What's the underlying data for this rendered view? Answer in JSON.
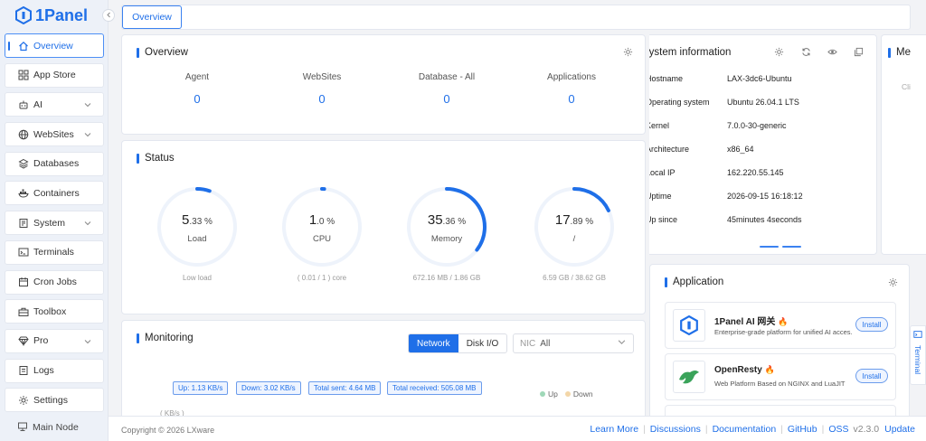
{
  "app": {
    "name": "1Panel"
  },
  "nav": [
    {
      "label": "Overview",
      "icon": "home-icon",
      "active": true
    },
    {
      "label": "App Store",
      "icon": "grid-icon"
    },
    {
      "label": "AI",
      "icon": "robot-icon",
      "expand": true
    },
    {
      "label": "WebSites",
      "icon": "globe-icon",
      "expand": true
    },
    {
      "label": "Databases",
      "icon": "database-icon"
    },
    {
      "label": "Containers",
      "icon": "docker-icon"
    },
    {
      "label": "System",
      "icon": "system-icon",
      "expand": true
    },
    {
      "label": "Terminals",
      "icon": "terminal-icon"
    },
    {
      "label": "Cron Jobs",
      "icon": "calendar-icon"
    },
    {
      "label": "Toolbox",
      "icon": "toolbox-icon"
    },
    {
      "label": "Pro",
      "icon": "diamond-icon",
      "expand": true
    },
    {
      "label": "Logs",
      "icon": "logs-icon"
    },
    {
      "label": "Settings",
      "icon": "gear-icon"
    }
  ],
  "node": {
    "label": "Main Node"
  },
  "tabs": {
    "overview": "Overview"
  },
  "overview": {
    "title": "Overview",
    "stats": [
      {
        "label": "Agent",
        "value": "0"
      },
      {
        "label": "WebSites",
        "value": "0"
      },
      {
        "label": "Database - All",
        "value": "0"
      },
      {
        "label": "Applications",
        "value": "0"
      }
    ]
  },
  "status": {
    "title": "Status",
    "gauges": [
      {
        "int": "5",
        "dec": ".33 %",
        "label": "Load",
        "sub": "Low load",
        "fraction": 0.0533
      },
      {
        "int": "1",
        "dec": ".0 %",
        "label": "CPU",
        "sub": "( 0.01 / 1 ) core",
        "fraction": 0.01
      },
      {
        "int": "35",
        "dec": ".36 %",
        "label": "Memory",
        "sub": "672.16 MB / 1.86 GB",
        "fraction": 0.3536
      },
      {
        "int": "17",
        "dec": ".89 %",
        "label": "/",
        "sub": "6.59 GB / 38.62 GB",
        "fraction": 0.1789
      }
    ]
  },
  "monitoring": {
    "title": "Monitoring",
    "seg": [
      "Network",
      "Disk I/O"
    ],
    "nic_label": "NIC",
    "nic_value": "All",
    "chips": [
      "Up: 1.13 KB/s",
      "Down: 3.02 KB/s",
      "Total sent: 4.64 MB",
      "Total received: 505.08 MB"
    ],
    "legend_up": "Up",
    "legend_down": "Down",
    "unit": "( KB/s )"
  },
  "system": {
    "title": "System information",
    "rows": [
      {
        "k": "Hostname",
        "v": "LAX-3dc6-Ubuntu"
      },
      {
        "k": "Operating system",
        "v": "Ubuntu 26.04.1 LTS"
      },
      {
        "k": "Kernel",
        "v": "7.0.0-30-generic"
      },
      {
        "k": "Architecture",
        "v": "x86_64"
      },
      {
        "k": "Local IP",
        "v": "162.220.55.145"
      },
      {
        "k": "Uptime",
        "v": "2026-09-15 16:18:12"
      },
      {
        "k": "Up since",
        "v": "45minutes 4seconds"
      }
    ]
  },
  "memo": {
    "title": "Me",
    "hint": "Cli"
  },
  "application": {
    "title": "Application",
    "items": [
      {
        "name": "1Panel AI 网关",
        "desc": "Enterprise-grade platform for unified AI acces...",
        "button": "Install"
      },
      {
        "name": "OpenResty",
        "desc": "Web Platform Based on NGINX and LuaJIT",
        "button": "Install"
      }
    ]
  },
  "footer": {
    "copyright": "Copyright © 2026 LXware",
    "links": [
      "Learn More",
      "Discussions",
      "Documentation",
      "GitHub",
      "OSS"
    ],
    "version": "v2.3.0",
    "update": "Update"
  },
  "terminal": {
    "label": "Terminal"
  },
  "colors": {
    "accent": "#1f6fe8",
    "track": "#eef3fb"
  }
}
